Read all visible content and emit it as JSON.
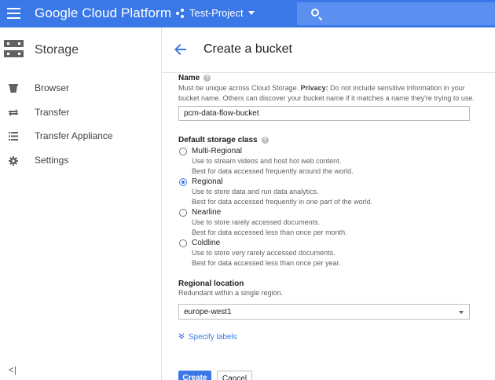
{
  "topbar": {
    "brand": "Google Cloud Platform",
    "project": "Test-Project",
    "accent": "#3b78e7"
  },
  "sidebar": {
    "title": "Storage",
    "items": [
      {
        "label": "Browser",
        "icon": "bucket-icon"
      },
      {
        "label": "Transfer",
        "icon": "transfer-icon"
      },
      {
        "label": "Transfer Appliance",
        "icon": "list-icon"
      },
      {
        "label": "Settings",
        "icon": "gear-icon"
      }
    ]
  },
  "page": {
    "title": "Create a bucket"
  },
  "form": {
    "name_label": "Name",
    "name_desc_1": "Must be unique across Cloud Storage.",
    "name_desc_privacy": "Privacy:",
    "name_desc_2": "Do not include sensitive information in your bucket name. Others can discover your bucket name if it matches a name they're trying to use.",
    "name_value": "pcm-data-flow-bucket",
    "storage_class_label": "Default storage class",
    "storage_classes": [
      {
        "label": "Multi-Regional",
        "line1": "Use to stream videos and host hot web content.",
        "line2": "Best for data accessed frequently around the world.",
        "checked": false
      },
      {
        "label": "Regional",
        "line1": "Use to store data and run data analytics.",
        "line2": "Best for data accessed frequently in one part of the world.",
        "checked": true
      },
      {
        "label": "Nearline",
        "line1": "Use to store rarely accessed documents.",
        "line2": "Best for data accessed less than once per month.",
        "checked": false
      },
      {
        "label": "Coldline",
        "line1": "Use to store very rarely accessed documents.",
        "line2": "Best for data accessed less than once per year.",
        "checked": false
      }
    ],
    "location_label": "Regional location",
    "location_desc": "Redundant within a single region.",
    "location_value": "europe-west1",
    "specify_labels": "Specify labels",
    "create_label": "Create",
    "cancel_label": "Cancel"
  }
}
